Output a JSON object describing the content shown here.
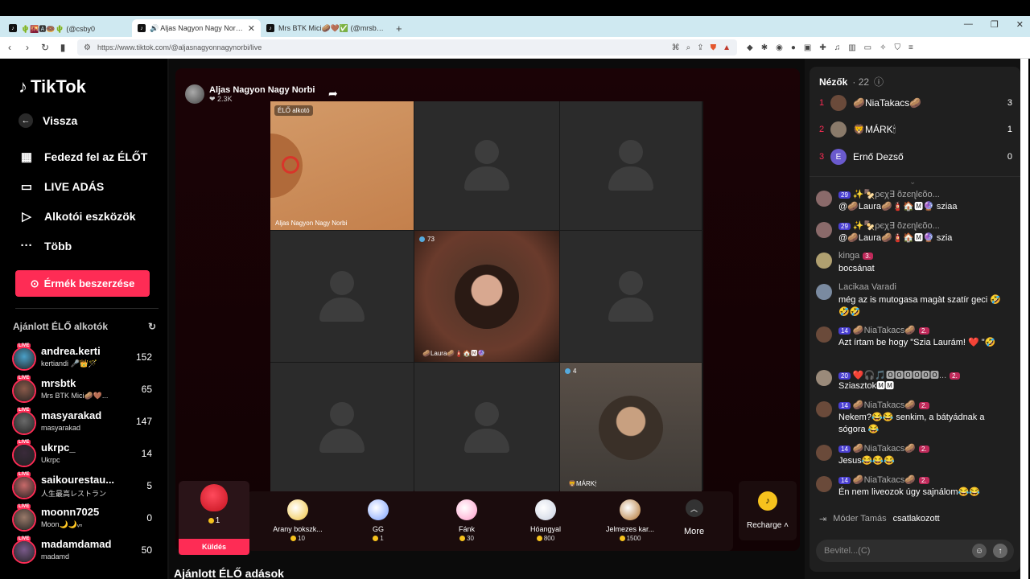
{
  "browser": {
    "tabs": [
      {
        "title": "🌵🌇🅰🍩🌵 (@csby0"
      },
      {
        "title": "🔊 Aljas Nagyon Nagy Norbi (@a"
      },
      {
        "title": "Mrs BTK Mici🥔🤎✅ (@mrsbtk) T"
      }
    ],
    "url": "https://www.tiktok.com/@aljasnagyonnagynorbi/live"
  },
  "sidebar": {
    "logo": "TikTok",
    "nav": [
      {
        "label": "Vissza",
        "icon": "arrow-left-icon"
      },
      {
        "label": "Fedezd fel az ÉLŐT",
        "icon": "calendar-live-icon"
      },
      {
        "label": "LIVE ADÁS",
        "icon": "video-camera-icon"
      },
      {
        "label": "Alkotói eszközök",
        "icon": "creator-tools-icon"
      },
      {
        "label": "Több",
        "icon": "more-dots-icon"
      }
    ],
    "coin_button": "Érmék beszerzése",
    "recommended_title": "Ajánlott ÉLŐ alkotók",
    "creators": [
      {
        "name": "andrea.kerti",
        "sub": "kertiandi 🎤👑🪄",
        "count": "152",
        "color": "#4aa0c8"
      },
      {
        "name": "mrsbtk",
        "sub": "Mrs BTK Mici🥔🤎...",
        "count": "65",
        "color": "#8a5a4a"
      },
      {
        "name": "masyarakad",
        "sub": "masyarakad",
        "count": "147",
        "color": "#6a6a6a"
      },
      {
        "name": "ukrpc_",
        "sub": "Ukrpc",
        "count": "14",
        "color": "#3a2a3a"
      },
      {
        "name": "saikourestau...",
        "sub": "人生最高レストラン",
        "count": "5",
        "color": "#c86a6a"
      },
      {
        "name": "moonn7025",
        "sub": "Moon🌙🌙ᵥₙ",
        "count": "0",
        "color": "#9a7a6a"
      },
      {
        "name": "madamdamad",
        "sub": "madamd",
        "count": "50",
        "color": "#7a5a8a"
      }
    ]
  },
  "stream": {
    "host_name": "Aljas Nagyon Nagy Norbi",
    "host_likes": "2.3K",
    "live_label": "ÉLŐ alkotó",
    "host_cell_name": "Aljas Nagyon Nagy Norbi",
    "laura_viewers": "73",
    "laura_tag": "🥔Laura🥔🧯🏠🅼🔮",
    "mark_viewers": "4",
    "mark_tag": "🦁MÁRK🕯"
  },
  "gifts": {
    "selected": {
      "count": "1",
      "send": "Küldés"
    },
    "items": [
      {
        "name": "Arany bokszk...",
        "price": "10",
        "color": "#f0c23a"
      },
      {
        "name": "GG",
        "price": "1",
        "color": "#7aa0ff"
      },
      {
        "name": "Fánk",
        "price": "30",
        "color": "#ff9ac8"
      },
      {
        "name": "Hóangyal",
        "price": "800",
        "color": "#c8d0e0"
      },
      {
        "name": "Jelmezes kar...",
        "price": "1500",
        "color": "#b0702a"
      }
    ],
    "more": "More",
    "recharge": "Recharge"
  },
  "recommended_section": "Ajánlott ÉLŐ adások",
  "viewers": {
    "title": "Nézők",
    "count": "22",
    "list": [
      {
        "rank": "1",
        "name": "🥔NiaTakacs🥔",
        "score": "3",
        "color": "#6a4a3a"
      },
      {
        "rank": "2",
        "name": "🦁MÁRK🕯",
        "score": "1",
        "color": "#8a7a6a"
      },
      {
        "rank": "3",
        "name": "Ernő Dezső",
        "score": "0",
        "color": "#6a5acd",
        "initial": "E"
      }
    ]
  },
  "chat": [
    {
      "level": "29",
      "header": "✨🍢ρєχ∃ õzєɳƖєõo...",
      "text": "@🥔Laura🥔🧯🏠🅼🔮 sziaa",
      "color": "#8a6a6a"
    },
    {
      "level": "29",
      "header": "✨🍢ρєχ∃ õzєɳƖєõo...",
      "text": "@🥔Laura🥔🧯🏠🅼🔮 szia",
      "color": "#8a6a6a"
    },
    {
      "level": "",
      "header": "kinga",
      "fan": "3.",
      "text": "bocsánat",
      "color": "#b0a070"
    },
    {
      "level": "",
      "header": "Lacikaa Varadi",
      "text": "még az is mutogasa magàt szatír geci 🤣🤣🤣",
      "color": "#7a8aa0"
    },
    {
      "level": "14",
      "header": "🥔NiaTakacs🥔",
      "fan": "2.",
      "text": "Azt írtam be hogy \"Szia Laurám! ❤️ \"🤣",
      "color": "#6a4a3a"
    },
    {
      "level": "20",
      "header": "❤️🎧🎵🅾🅾🅾🅾🅾🅾...",
      "fan": "2.",
      "text": "Sziasztok🅼🅼",
      "color": "#9a8a7a"
    },
    {
      "level": "14",
      "header": "🥔NiaTakacs🥔",
      "fan": "2.",
      "text": "Nekem?😂😂 senkim, a bátyádnak a sógora 😂",
      "color": "#6a4a3a"
    },
    {
      "level": "14",
      "header": "🥔NiaTakacs🥔",
      "fan": "2.",
      "text": "Jesus😂😂😂",
      "color": "#6a4a3a"
    },
    {
      "level": "14",
      "header": "🥔NiaTakacs🥔",
      "fan": "2.",
      "text": "Én nem liveozok úgy sajnálom😂😂",
      "color": "#6a4a3a"
    }
  ],
  "joined": {
    "name": "Móder Tamás",
    "action": "csatlakozott"
  },
  "input": {
    "placeholder": "Bevitel...(C)"
  }
}
